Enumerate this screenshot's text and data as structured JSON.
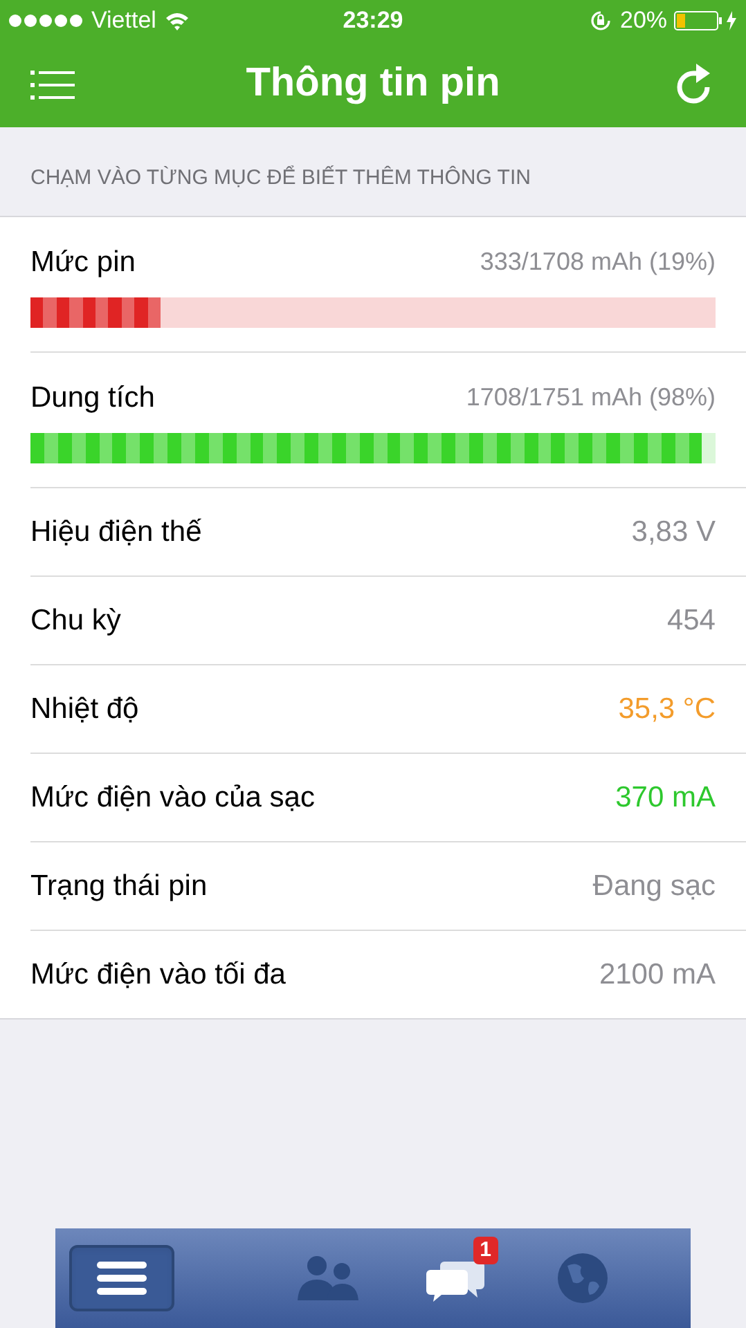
{
  "status_bar": {
    "carrier": "Viettel",
    "time": "23:29",
    "battery": "20%"
  },
  "nav_bar": {
    "title": "Thông tin pin"
  },
  "section_header": "CHẠM VÀO TỪNG MỤC ĐỂ BIẾT THÊM THÔNG TIN",
  "rows": [
    {
      "kind": "bar",
      "label": "Mức pin",
      "value": "333/1708 mAh (19%)",
      "level": 0.19,
      "color": "#e02424"
    },
    {
      "kind": "bar",
      "label": "Dung tích",
      "value": "1708/1751 mAh (98%)",
      "level": 0.98,
      "color": "#3ad42a"
    },
    {
      "kind": "plain",
      "label": "Hiệu điện thế",
      "value": "3,83 V",
      "color": "#8e8e93"
    },
    {
      "kind": "plain",
      "label": "Chu kỳ",
      "value": "454",
      "color": "#8e8e93"
    },
    {
      "kind": "plain",
      "label": "Nhiệt độ",
      "value": "35,3 °C",
      "color": "#f39c2b"
    },
    {
      "kind": "plain",
      "label": "Mức điện vào của sạc",
      "value": "370 mA",
      "color": "#2ec82e"
    },
    {
      "kind": "plain",
      "label": "Trạng thái pin",
      "value": "Đang sạc",
      "color": "#8e8e93"
    },
    {
      "kind": "plain",
      "label": "Mức điện vào tối đa",
      "value": "2100 mA",
      "color": "#8e8e93"
    }
  ],
  "bottom_bar": {
    "items": [
      {
        "kind": "menu",
        "selected": true
      },
      {
        "kind": "people",
        "selected": false
      },
      {
        "kind": "chat",
        "selected": false,
        "badge": "1"
      },
      {
        "kind": "globe",
        "selected": false
      }
    ]
  }
}
